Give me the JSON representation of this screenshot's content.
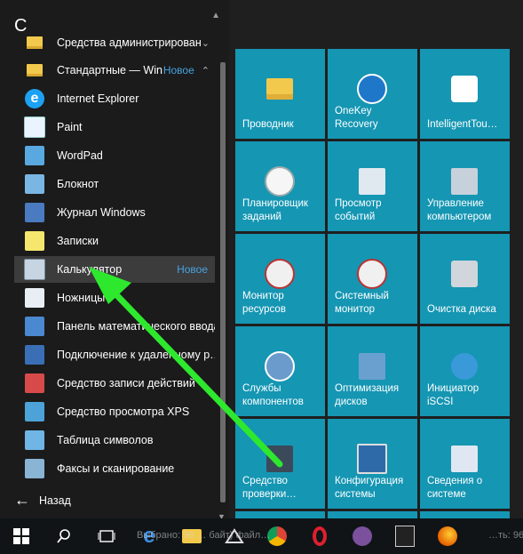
{
  "start_menu": {
    "current_letter": "С",
    "back_label": "Назад",
    "items": [
      {
        "label": "Средства администрирован…",
        "badge": "",
        "icon": "folder-icon"
      },
      {
        "label": "Стандартные — Win…",
        "badge": "Новое",
        "icon": "folder-icon"
      },
      {
        "label": "Internet Explorer",
        "badge": "",
        "icon": "internet-explorer-icon"
      },
      {
        "label": "Paint",
        "badge": "",
        "icon": "paint-icon"
      },
      {
        "label": "WordPad",
        "badge": "",
        "icon": "wordpad-icon"
      },
      {
        "label": "Блокнот",
        "badge": "",
        "icon": "notepad-icon"
      },
      {
        "label": "Журнал Windows",
        "badge": "",
        "icon": "windows-journal-icon"
      },
      {
        "label": "Записки",
        "badge": "",
        "icon": "sticky-notes-icon"
      },
      {
        "label": "Калькулятор",
        "badge": "Новое",
        "icon": "calculator-icon"
      },
      {
        "label": "Ножницы",
        "badge": "",
        "icon": "snipping-tool-icon"
      },
      {
        "label": "Панель математического ввода",
        "badge": "",
        "icon": "math-input-icon"
      },
      {
        "label": "Подключение к удаленному р…",
        "badge": "",
        "icon": "remote-desktop-icon"
      },
      {
        "label": "Средство записи действий",
        "badge": "",
        "icon": "steps-recorder-icon"
      },
      {
        "label": "Средство просмотра XPS",
        "badge": "",
        "icon": "xps-viewer-icon"
      },
      {
        "label": "Таблица символов",
        "badge": "",
        "icon": "character-map-icon"
      },
      {
        "label": "Факсы и сканирование",
        "badge": "",
        "icon": "fax-scan-icon"
      }
    ]
  },
  "tiles": [
    {
      "label": "Проводник",
      "icon": "file-explorer-icon"
    },
    {
      "label": "OneKey\nRecovery",
      "icon": "onekey-recovery-icon"
    },
    {
      "label": "IntelligentTou…",
      "icon": "intelligent-touch-icon"
    },
    {
      "label": "Планировщик\nзаданий",
      "icon": "task-scheduler-icon"
    },
    {
      "label": "Просмотр\nсобытий",
      "icon": "event-viewer-icon"
    },
    {
      "label": "Управление\nкомпьютером",
      "icon": "computer-management-icon"
    },
    {
      "label": "Монитор\nресурсов",
      "icon": "resource-monitor-icon"
    },
    {
      "label": "Системный\nмонитор",
      "icon": "performance-monitor-icon"
    },
    {
      "label": "Очистка диска",
      "icon": "disk-cleanup-icon"
    },
    {
      "label": "Службы\nкомпонентов",
      "icon": "component-services-icon"
    },
    {
      "label": "Оптимизация\nдисков",
      "icon": "defragment-icon"
    },
    {
      "label": "Инициатор\niSCSI",
      "icon": "iscsi-initiator-icon"
    },
    {
      "label": "Средство\nпроверки…",
      "icon": "memory-diagnostic-icon"
    },
    {
      "label": "Конфигурация\nсистемы",
      "icon": "system-configuration-icon"
    },
    {
      "label": "Сведения о\nсистеме",
      "icon": "system-information-icon"
    }
  ],
  "taskbar": {
    "background_text": "Выбрано: 96 … байт) файл…",
    "right_text": "…ть: 96",
    "items": [
      "start-button",
      "search-icon",
      "task-view-icon",
      "edge-icon",
      "file-explorer-icon",
      "stalker-icon",
      "chrome-icon",
      "opera-icon",
      "viber-icon",
      "stereo-icon",
      "firefox-icon"
    ]
  },
  "colors": {
    "tile": "#1596b3",
    "accent_badge": "#46a3e0",
    "arrow": "#2ee82e"
  }
}
